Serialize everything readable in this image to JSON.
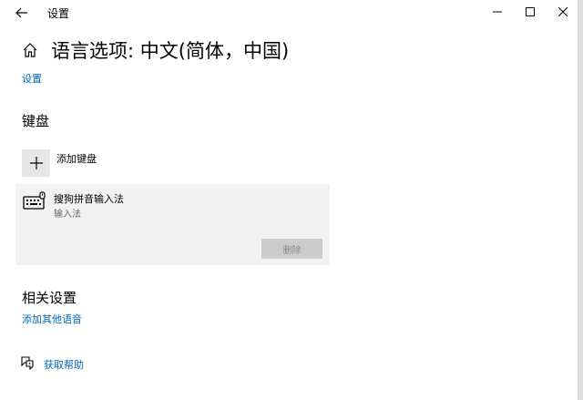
{
  "window": {
    "title": "设置",
    "controls": {
      "minimize": "minimize-icon",
      "maximize": "maximize-icon",
      "close": "close-icon"
    }
  },
  "page": {
    "title": "语言选项: 中文(简体，中国)",
    "breadcrumb": "设置"
  },
  "keyboard": {
    "heading": "键盘",
    "add_label": "添加键盘",
    "ime": {
      "name": "搜狗拼音输入法",
      "subtitle": "输入法",
      "remove_label": "删除"
    }
  },
  "related": {
    "heading": "相关设置",
    "link": "添加其他语音"
  },
  "help": {
    "label": "获取帮助"
  },
  "colors": {
    "link": "#0067b8",
    "panel_bg": "#f2f2f2",
    "button_disabled_bg": "#cccccc"
  }
}
